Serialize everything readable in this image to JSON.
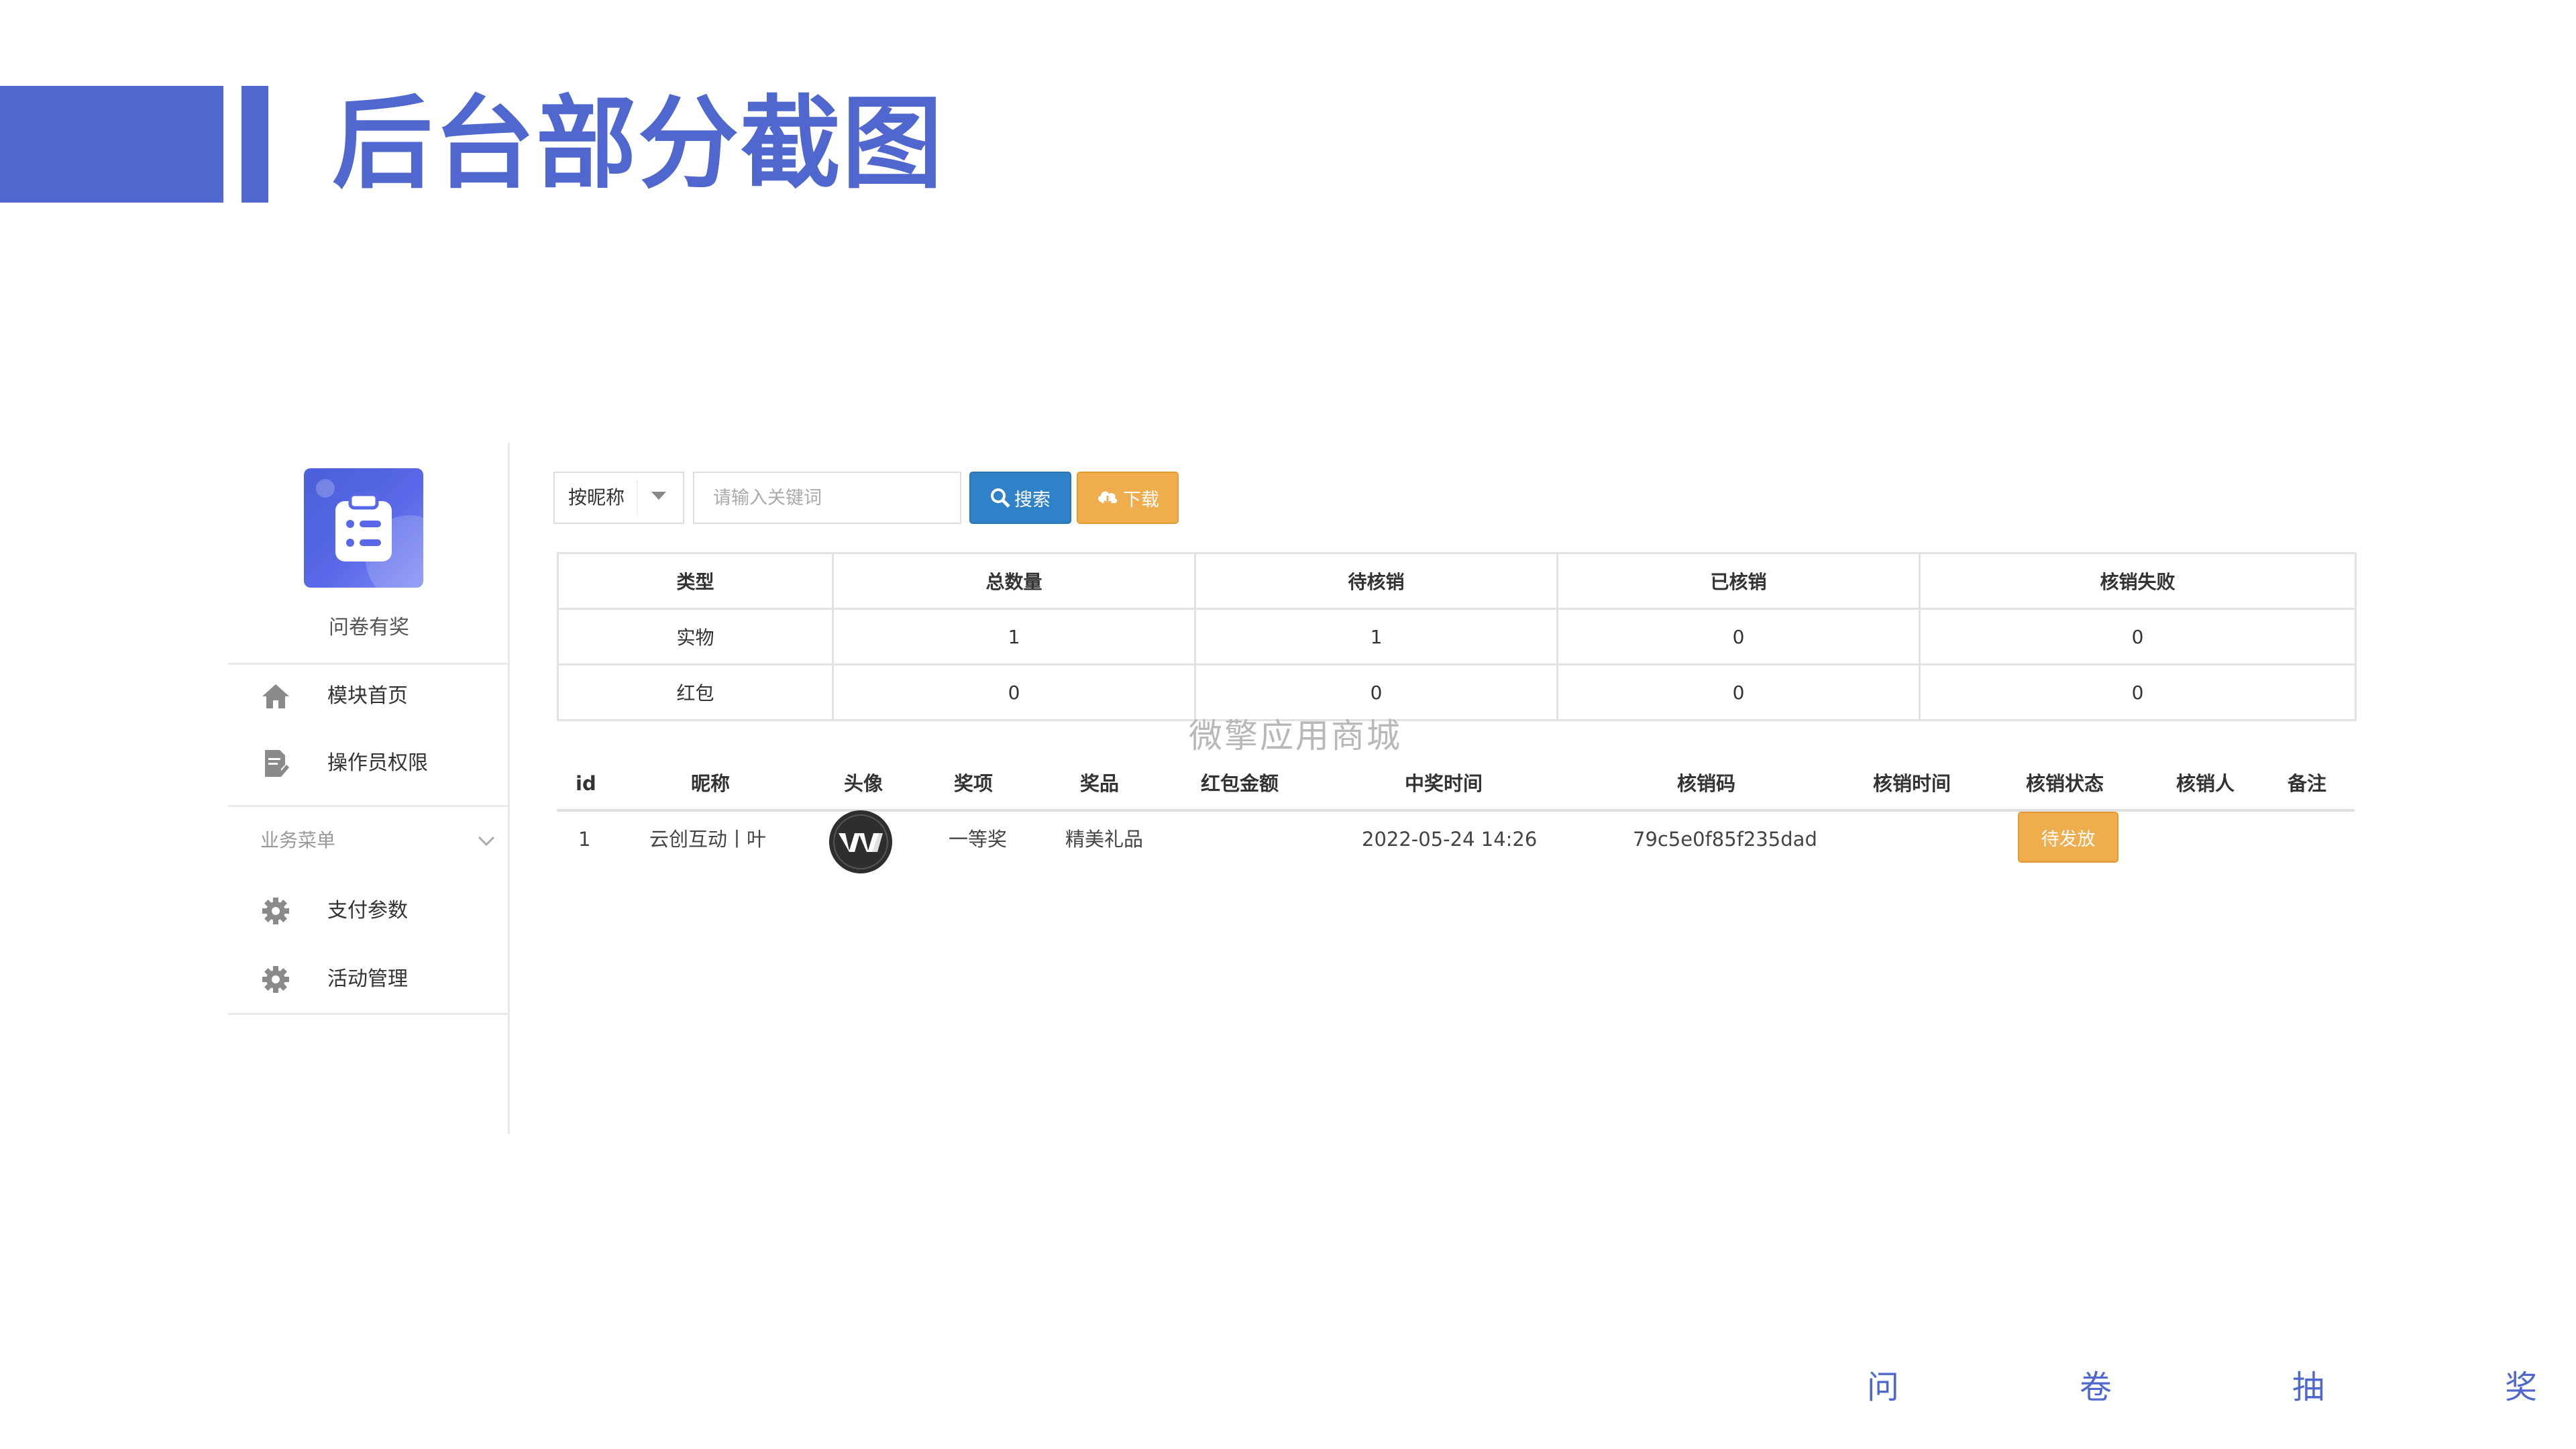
{
  "slide": {
    "title": "后台部分截图"
  },
  "sidebar": {
    "app_name": "问卷有奖",
    "items": [
      {
        "label": "模块首页",
        "icon": "home-icon"
      },
      {
        "label": "操作员权限",
        "icon": "document-edit-icon"
      }
    ],
    "group_label": "业务菜单",
    "group_items": [
      {
        "label": "支付参数",
        "icon": "gear-icon"
      },
      {
        "label": "活动管理",
        "icon": "gear-icon"
      }
    ]
  },
  "toolbar": {
    "select_value": "按昵称",
    "search_placeholder": "请输入关键词",
    "search_label": "搜索",
    "download_label": "下载"
  },
  "summary": {
    "headers": [
      "类型",
      "总数量",
      "待核销",
      "已核销",
      "核销失败"
    ],
    "rows": [
      [
        "实物",
        "1",
        "1",
        "0",
        "0"
      ],
      [
        "红包",
        "0",
        "0",
        "0",
        "0"
      ]
    ]
  },
  "watermark": "微擎应用商城",
  "detail": {
    "headers": [
      "id",
      "昵称",
      "头像",
      "奖项",
      "奖品",
      "红包金额",
      "中奖时间",
      "核销码",
      "核销时间",
      "核销状态",
      "核销人",
      "备注"
    ],
    "rows": [
      {
        "id": "1",
        "nickname": "云创互动丨叶",
        "prize_level": "一等奖",
        "prize": "精美礼品",
        "red_packet": "",
        "win_time": "2022-05-24 14:26",
        "code": "79c5e0f85f235dad",
        "verify_time": "",
        "status": "待发放",
        "verifier": "",
        "remark": ""
      }
    ]
  },
  "footer": [
    "问",
    "卷",
    "抽",
    "奖"
  ],
  "colors": {
    "brand": "#4f67cf",
    "search": "#2f82c8",
    "warning": "#f0ad4e"
  }
}
